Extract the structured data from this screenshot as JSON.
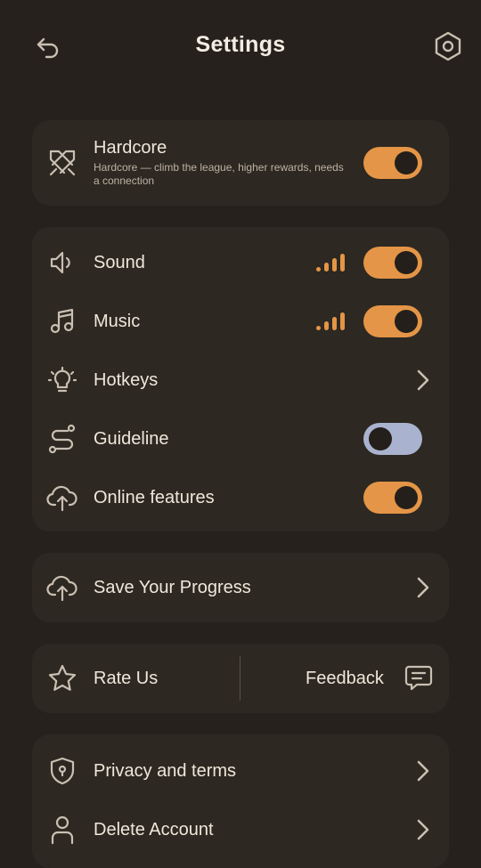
{
  "header": {
    "title": "Settings",
    "back_icon": "back-arrow-icon",
    "gear_icon": "gear-icon"
  },
  "hardcore": {
    "title": "Hardcore",
    "description": "Hardcore — climb the league, higher rewards, needs a connection",
    "enabled": true,
    "icon": "crossed-swords-icon"
  },
  "settings": {
    "sound": {
      "label": "Sound",
      "enabled": true,
      "volume_level": 4,
      "volume_max": 4,
      "icon": "speaker-icon"
    },
    "music": {
      "label": "Music",
      "enabled": true,
      "volume_level": 4,
      "volume_max": 4,
      "icon": "music-note-icon"
    },
    "hotkeys": {
      "label": "Hotkeys",
      "icon": "lightbulb-icon"
    },
    "guideline": {
      "label": "Guideline",
      "enabled": false,
      "icon": "route-icon"
    },
    "online": {
      "label": "Online features",
      "enabled": true,
      "icon": "cloud-upload-icon"
    }
  },
  "save_progress": {
    "label": "Save Your Progress",
    "icon": "cloud-upload-icon"
  },
  "rate": {
    "label": "Rate Us",
    "icon": "star-icon"
  },
  "feedback": {
    "label": "Feedback",
    "icon": "chat-bubble-icon"
  },
  "account": {
    "privacy": {
      "label": "Privacy and terms",
      "icon": "shield-lock-icon"
    },
    "delete": {
      "label": "Delete Account",
      "icon": "user-icon"
    }
  },
  "colors": {
    "background": "#26211c",
    "card": "#2d2821",
    "accent": "#e49547",
    "toggle_off": "#a9b2ce",
    "icon": "#c9bfb2"
  }
}
